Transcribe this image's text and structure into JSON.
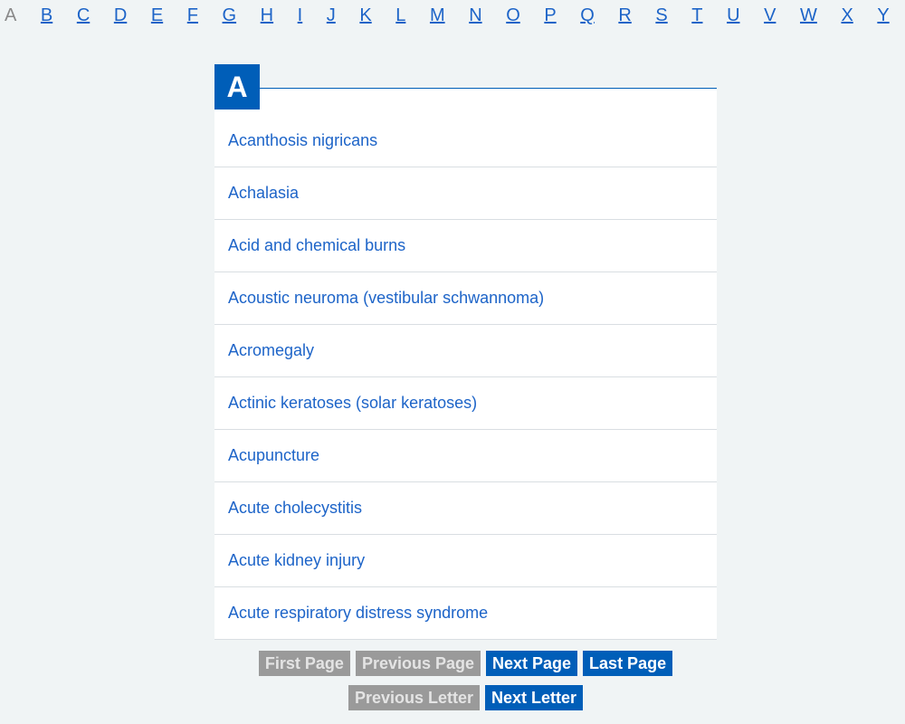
{
  "alphabet": {
    "current": "A",
    "letters": [
      "B",
      "C",
      "D",
      "E",
      "F",
      "G",
      "H",
      "I",
      "J",
      "K",
      "L",
      "M",
      "N",
      "O",
      "P",
      "Q",
      "R",
      "S",
      "T",
      "U",
      "V",
      "W",
      "X",
      "Y"
    ]
  },
  "section": {
    "letter": "A"
  },
  "items": [
    "Acanthosis nigricans",
    "Achalasia",
    "Acid and chemical burns",
    "Acoustic neuroma (vestibular schwannoma)",
    "Acromegaly",
    "Actinic keratoses (solar keratoses)",
    "Acupuncture",
    "Acute cholecystitis",
    "Acute kidney injury",
    "Acute respiratory distress syndrome"
  ],
  "pagination": {
    "first_page": "First Page",
    "previous_page": "Previous Page",
    "next_page": "Next Page",
    "last_page": "Last Page",
    "previous_letter": "Previous Letter",
    "next_letter": "Next Letter"
  },
  "colors": {
    "accent": "#005eb8",
    "link": "#1d64c8",
    "background": "#f0f4f5",
    "disabled": "#9a9a9a"
  }
}
